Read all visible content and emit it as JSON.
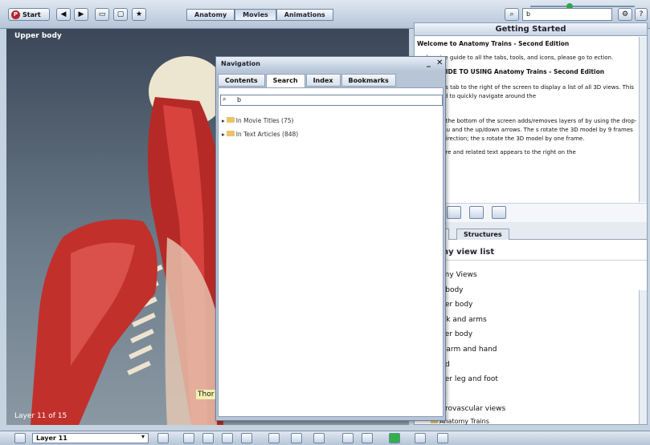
{
  "toolbar": {
    "start_label": "Start",
    "tabs": [
      "Anatomy",
      "Movies",
      "Animations"
    ],
    "search_value": "b"
  },
  "viewer": {
    "title": "Upper body",
    "layer_label": "Layer 11 of 15",
    "tooltip_text": "Thor"
  },
  "getting_started": {
    "title": "Getting Started",
    "welcome": "Welcome to Anatomy Trains - Second Edition",
    "intro_text": "prehensive guide to all the tabs, tools, and icons, please go to ection.",
    "quick_start_heading": "TART GUIDE TO USING Anatomy Trains - Second Edition",
    "views_text": "e 3D Views tab to the right of the screen to display a list of all 3D views. This tab is used to quickly navigate around the",
    "y_letter": "y",
    "layers_text": "control at the bottom of the screen adds/removes layers of by using the drop-down menu and the up/down arrows. The s rotate the 3D model by 9 frames in either direction; the s rotate the 3D model by one frame.",
    "structure_text": "ny structure and related text appears to the right on the"
  },
  "anatomy_panel": {
    "tabs": [
      "s",
      "Structures"
    ],
    "heading": "tomy view list",
    "items": [
      "atomy Views",
      "Full body",
      "Upper body",
      "Trunk and arms",
      "Lower body",
      "Forearm and hand",
      "Hand",
      "Lower leg and foot",
      "Foot",
      "Neurovascular views",
      "Anatomy Trains"
    ]
  },
  "navigation": {
    "title": "Navigation",
    "tabs": [
      "Contents",
      "Search",
      "Index",
      "Bookmarks"
    ],
    "search_value": "b",
    "results": [
      "In Movie Titles (75)",
      "In Text Articles (848)"
    ]
  },
  "bottom": {
    "layer_select": "Layer 11"
  }
}
